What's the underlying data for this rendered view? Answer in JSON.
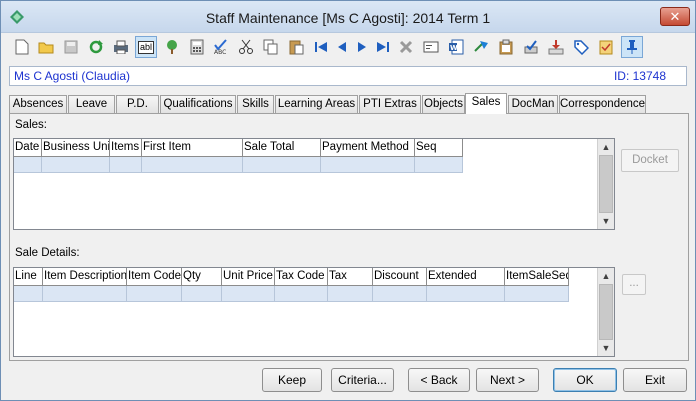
{
  "window": {
    "title": "Staff Maintenance  [Ms C Agosti]:  2014 Term 1",
    "close_label": "✕"
  },
  "toolbar": {
    "icons": [
      "new-icon",
      "open-folder-icon",
      "save-icon",
      "refresh-icon",
      "print-icon",
      "text-field-icon",
      "tree-icon",
      "calculator-icon",
      "spellcheck-icon",
      "cut-icon",
      "copy-icon",
      "paste-icon",
      "first-record-icon",
      "previous-record-icon",
      "next-record-icon",
      "last-record-icon",
      "delete-icon",
      "card-icon",
      "word-icon",
      "arrow-right-icon",
      "clipboard-icon",
      "approve-icon",
      "download-icon",
      "tag-icon",
      "checklist-icon",
      "pin-icon"
    ],
    "abl_label": "abl"
  },
  "staff": {
    "name": "Ms C Agosti (Claudia)",
    "id_label": "ID: 13748"
  },
  "tabs": [
    "Absences",
    "Leave",
    "P.D.",
    "Qualifications",
    "Skills",
    "Learning Areas",
    "PTI Extras",
    "Objects",
    "Sales",
    "DocMan",
    "Correspondence"
  ],
  "active_tab": "Sales",
  "sales": {
    "label": "Sales:",
    "columns": [
      "Date",
      "Business Unit",
      "Items",
      "First Item",
      "Sale Total",
      "Payment Method",
      "Seq"
    ],
    "docket_label": "Docket"
  },
  "sale_details": {
    "label": "Sale Details:",
    "columns": [
      "Line",
      "Item Description",
      "Item Code",
      "Qty",
      "Unit Price",
      "Tax Code",
      "Tax",
      "Discount",
      "Extended",
      "ItemSaleSeq"
    ],
    "ellipsis_label": "..."
  },
  "buttons": {
    "keep": "Keep",
    "criteria": "Criteria...",
    "back": "< Back",
    "next": "Next >",
    "ok": "OK",
    "exit": "Exit"
  },
  "colors": {
    "accent_blue": "#1d33d0",
    "grid_row": "#dbe6f4",
    "title_bg": "#c6d7ec"
  }
}
